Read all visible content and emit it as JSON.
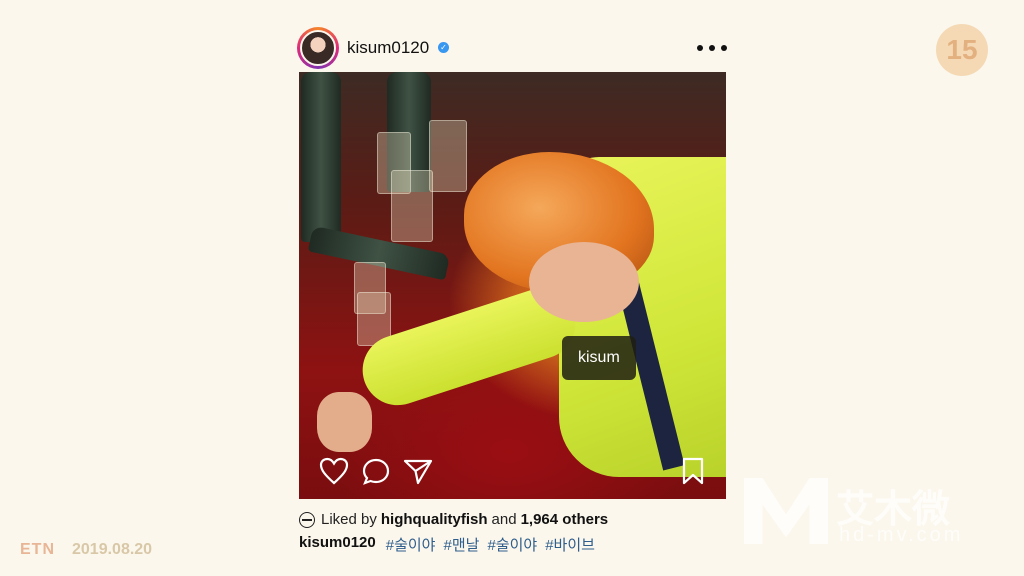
{
  "post": {
    "username": "kisum0120",
    "verified_mark": "✓",
    "photo_tag": "kisum",
    "liked_by_prefix": "Liked by",
    "liked_by_user": "highqualityfish",
    "liked_by_joiner": "and",
    "liked_by_others": "1,964 others",
    "caption_user": "kisum0120",
    "hashtags": [
      "#술이야",
      "#맨날",
      "#술이야",
      "#바이브"
    ]
  },
  "page_number": "15",
  "footer": {
    "logo": "ETN",
    "date": "2019.08.20"
  },
  "watermark": {
    "cn": "艾木微",
    "url": "hd-mv.com"
  },
  "icons": [
    "more-options-icon",
    "heart-icon",
    "comment-icon",
    "share-icon",
    "bookmark-icon",
    "verified-badge-icon"
  ],
  "colors": {
    "background": "#fbf7ec",
    "hashtag": "#2f5d8c",
    "verified": "#3897f0",
    "page_badge": "#f5d9b5"
  }
}
